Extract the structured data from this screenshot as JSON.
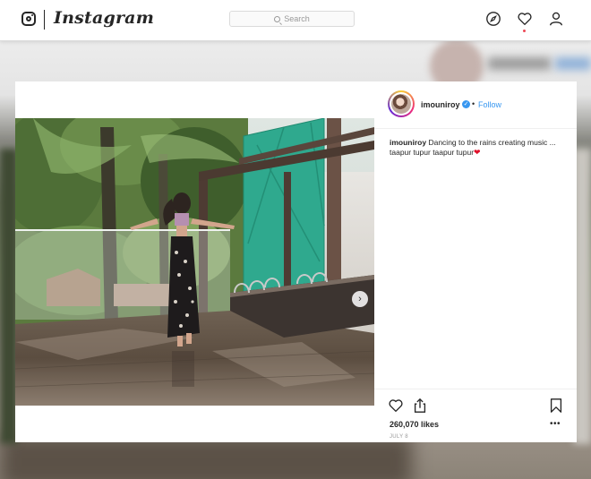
{
  "app": {
    "name": "Instagram"
  },
  "search": {
    "placeholder": "Search"
  },
  "nav": {
    "icons": [
      "compass-icon",
      "heart-icon",
      "profile-icon"
    ],
    "notification_dot": true
  },
  "post": {
    "username": "imouniroy",
    "verified": true,
    "follow_label": "Follow",
    "separator": "•",
    "caption_username": "imouniroy",
    "caption_line1": "Dancing to the rains creating music ...",
    "caption_line2": "taapur tupur taapur tupur",
    "caption_emoji": "❤",
    "likes": "260,070 likes",
    "date": "JULY 8",
    "more_label": "•••",
    "carousel_next": "›"
  },
  "colors": {
    "link": "#3897f0",
    "text": "#262626",
    "muted": "#999999",
    "heart": "#e0102a"
  }
}
